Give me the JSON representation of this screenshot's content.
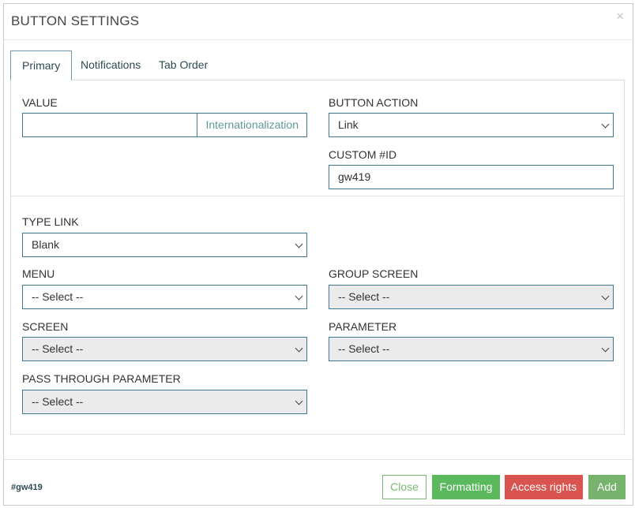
{
  "dialog": {
    "title": "BUTTON SETTINGS",
    "close_glyph": "×"
  },
  "tabs": [
    {
      "label": "Primary",
      "active": true
    },
    {
      "label": "Notifications",
      "active": false
    },
    {
      "label": "Tab Order",
      "active": false
    }
  ],
  "form": {
    "value": {
      "label": "VALUE",
      "input_value": "",
      "addon": "Internationalization"
    },
    "button_action": {
      "label": "BUTTON ACTION",
      "selected": "Link"
    },
    "custom_id": {
      "label": "CUSTOM #ID",
      "input_value": "gw419"
    },
    "type_link": {
      "label": "TYPE LINK",
      "selected": "Blank"
    },
    "menu": {
      "label": "MENU",
      "selected": "-- Select --"
    },
    "group_screen": {
      "label": "GROUP SCREEN",
      "selected": "-- Select --"
    },
    "screen": {
      "label": "SCREEN",
      "selected": "-- Select --"
    },
    "parameter": {
      "label": "PARAMETER",
      "selected": "-- Select --"
    },
    "pass_through_parameter": {
      "label": "PASS THROUGH PARAMETER",
      "selected": "-- Select --"
    }
  },
  "footer": {
    "element_id": "#gw419",
    "buttons": {
      "close": "Close",
      "formatting": "Formatting",
      "access_rights": "Access rights",
      "add": "Add"
    }
  },
  "colors": {
    "border_accent": "#3e7892",
    "success": "#5cb85c",
    "danger": "#d9534f",
    "disabled_bg": "#ebebeb"
  }
}
